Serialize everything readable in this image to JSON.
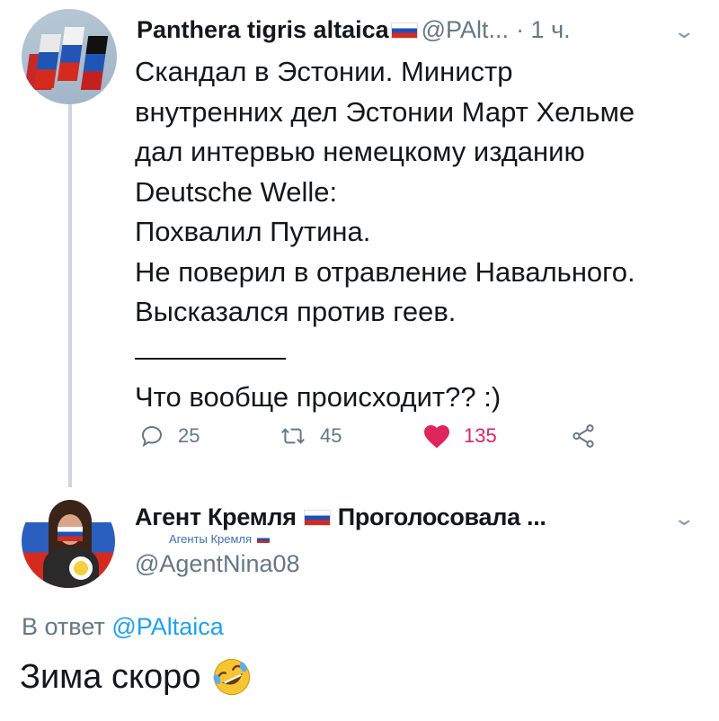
{
  "tweet1": {
    "author_name": "Panthera tigris altaica",
    "handle": "@PAlt...",
    "time": "· 1 ч.",
    "lines": [
      "Скандал в Эстонии. Министр",
      "внутренних дел Эстонии Март Хельме",
      "дал интервью немецкому изданию",
      "Deutsche Welle:",
      "Похвалил Путина.",
      "Не поверил в отравление Навального.",
      "Высказался против геев."
    ],
    "question": "Что вообще происходит?? :)",
    "replies_count": "25",
    "retweets_count": "45",
    "likes_count": "135"
  },
  "tweet2": {
    "author_name": "Агент Кремля",
    "bio_part": "Проголосовала ...",
    "watermark": "Агенты Кремля",
    "handle": "@AgentNina08",
    "reply_prefix": "В ответ",
    "reply_to": "@PAltaica",
    "text": "Зима скоро"
  },
  "icons": {
    "more": "chevron-down-icon",
    "reply": "reply-icon",
    "retweet": "retweet-icon",
    "like": "heart-icon",
    "share": "share-icon",
    "emoji": "rofl-emoji-icon"
  },
  "colors": {
    "like": "#e0245e",
    "link": "#1da1f2",
    "muted": "#657786"
  }
}
